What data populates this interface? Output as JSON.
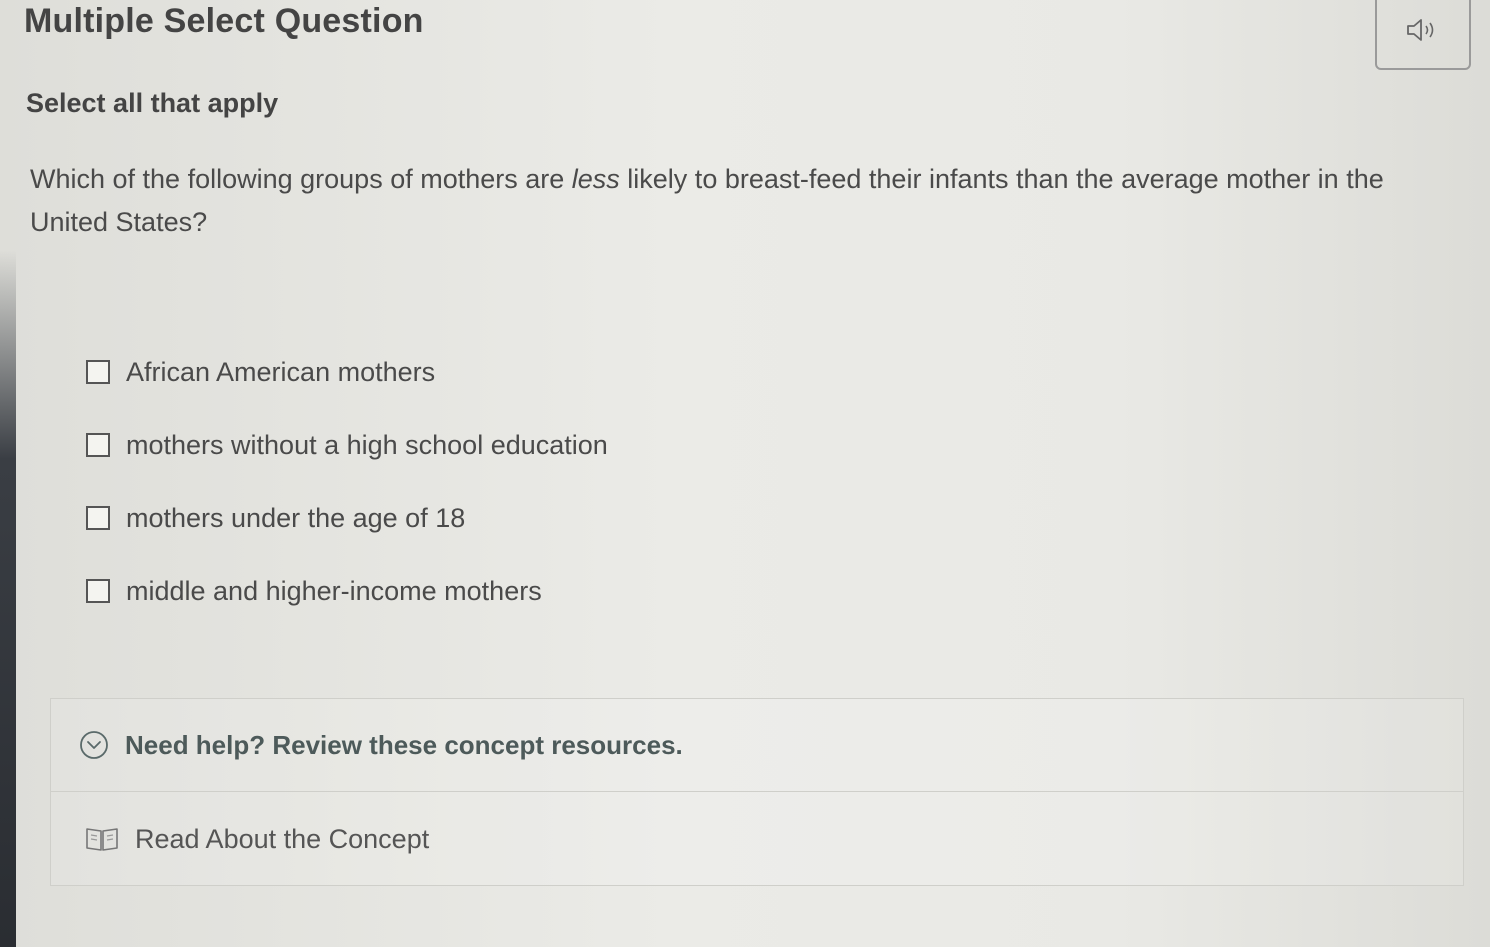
{
  "header": {
    "title": "Multiple Select Question",
    "audio_icon": "speaker-icon"
  },
  "question": {
    "instructions": "Select all that apply",
    "text_before": "Which of the following groups of mothers are ",
    "text_emphasis": "less",
    "text_after": " likely to breast-feed their infants than the average mother in the United States?"
  },
  "options": [
    {
      "label": "African American mothers",
      "checked": false
    },
    {
      "label": "mothers without a high school education",
      "checked": false
    },
    {
      "label": "mothers under the age of 18",
      "checked": false
    },
    {
      "label": "middle and higher-income mothers",
      "checked": false
    }
  ],
  "help": {
    "title": "Need help? Review these concept resources.",
    "toggle_icon": "chevron-down-circle-icon",
    "resources": [
      {
        "label": "Read About the Concept",
        "icon": "book-icon"
      }
    ]
  }
}
